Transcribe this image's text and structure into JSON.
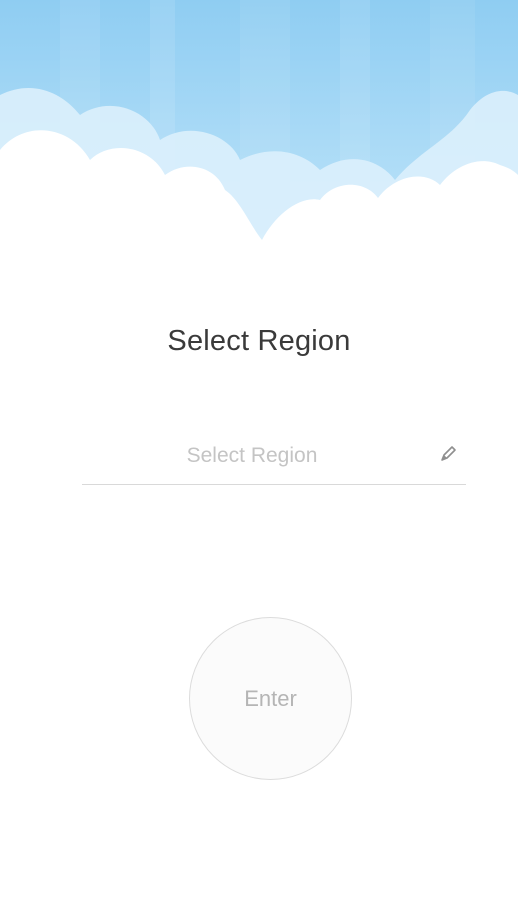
{
  "header": {
    "illustration": "sky-clouds-illustration",
    "sky_color": "#a9d8f5",
    "cloud_color": "#ffffff"
  },
  "title": "Select Region",
  "region_field": {
    "value": "",
    "placeholder": "Select Region",
    "icon": "pencil-icon"
  },
  "enter_button": {
    "label": "Enter"
  },
  "colors": {
    "background": "#ffffff",
    "title_text": "#3a3a3a",
    "placeholder_text": "#c4c4c4",
    "divider": "#d9d9d9",
    "button_border": "#dcdcdc"
  }
}
